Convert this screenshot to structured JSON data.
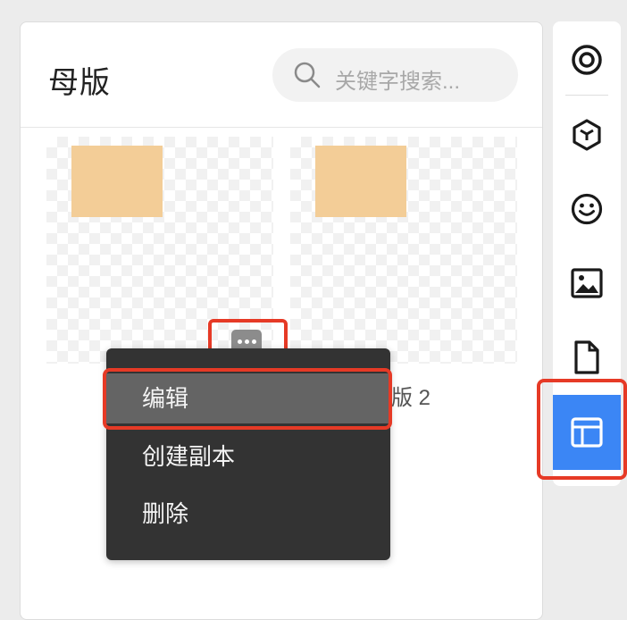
{
  "panel": {
    "title": "母版",
    "search": {
      "placeholder": "关键字搜索..."
    }
  },
  "cards": [
    {
      "label": "",
      "swatch_color": "#f3cd97"
    },
    {
      "label": "版 2",
      "swatch_color": "#f3cd97"
    }
  ],
  "more_button": {
    "icon": "more-horizontal-icon"
  },
  "context_menu": {
    "items": [
      {
        "label": "编辑",
        "highlighted": true
      },
      {
        "label": "创建副本"
      },
      {
        "label": "删除"
      }
    ]
  },
  "rail": {
    "items": [
      {
        "icon": "target-icon"
      },
      {
        "icon": "cube-icon"
      },
      {
        "icon": "smiley-icon"
      },
      {
        "icon": "image-icon"
      },
      {
        "icon": "file-icon"
      },
      {
        "icon": "layout-template-icon",
        "active": true
      }
    ]
  },
  "colors": {
    "accent": "#3b86f5",
    "annotation": "#e63a26",
    "menu_bg": "#333333",
    "menu_highlight": "#646464"
  }
}
